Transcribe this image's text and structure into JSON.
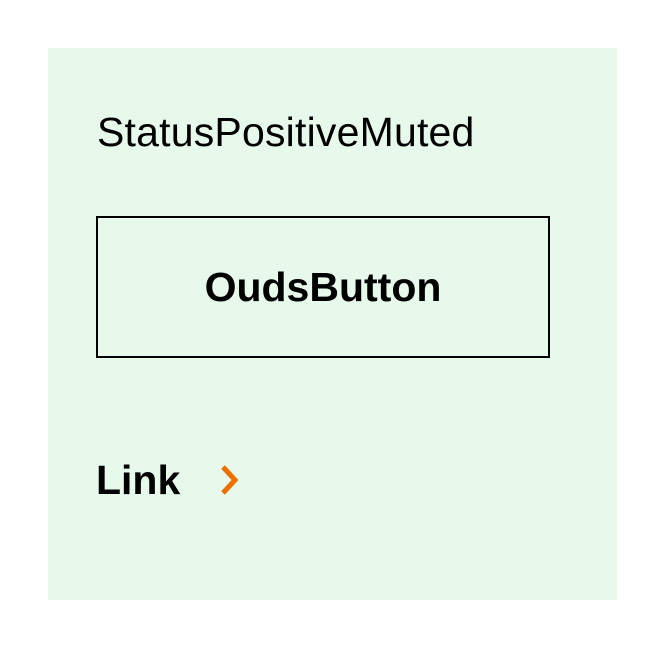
{
  "panel": {
    "title": "StatusPositiveMuted",
    "background_color": "#e6f9eb"
  },
  "button": {
    "label": "OudsButton"
  },
  "link": {
    "label": "Link",
    "icon": "chevron-right-icon",
    "icon_color": "#f16e00"
  }
}
